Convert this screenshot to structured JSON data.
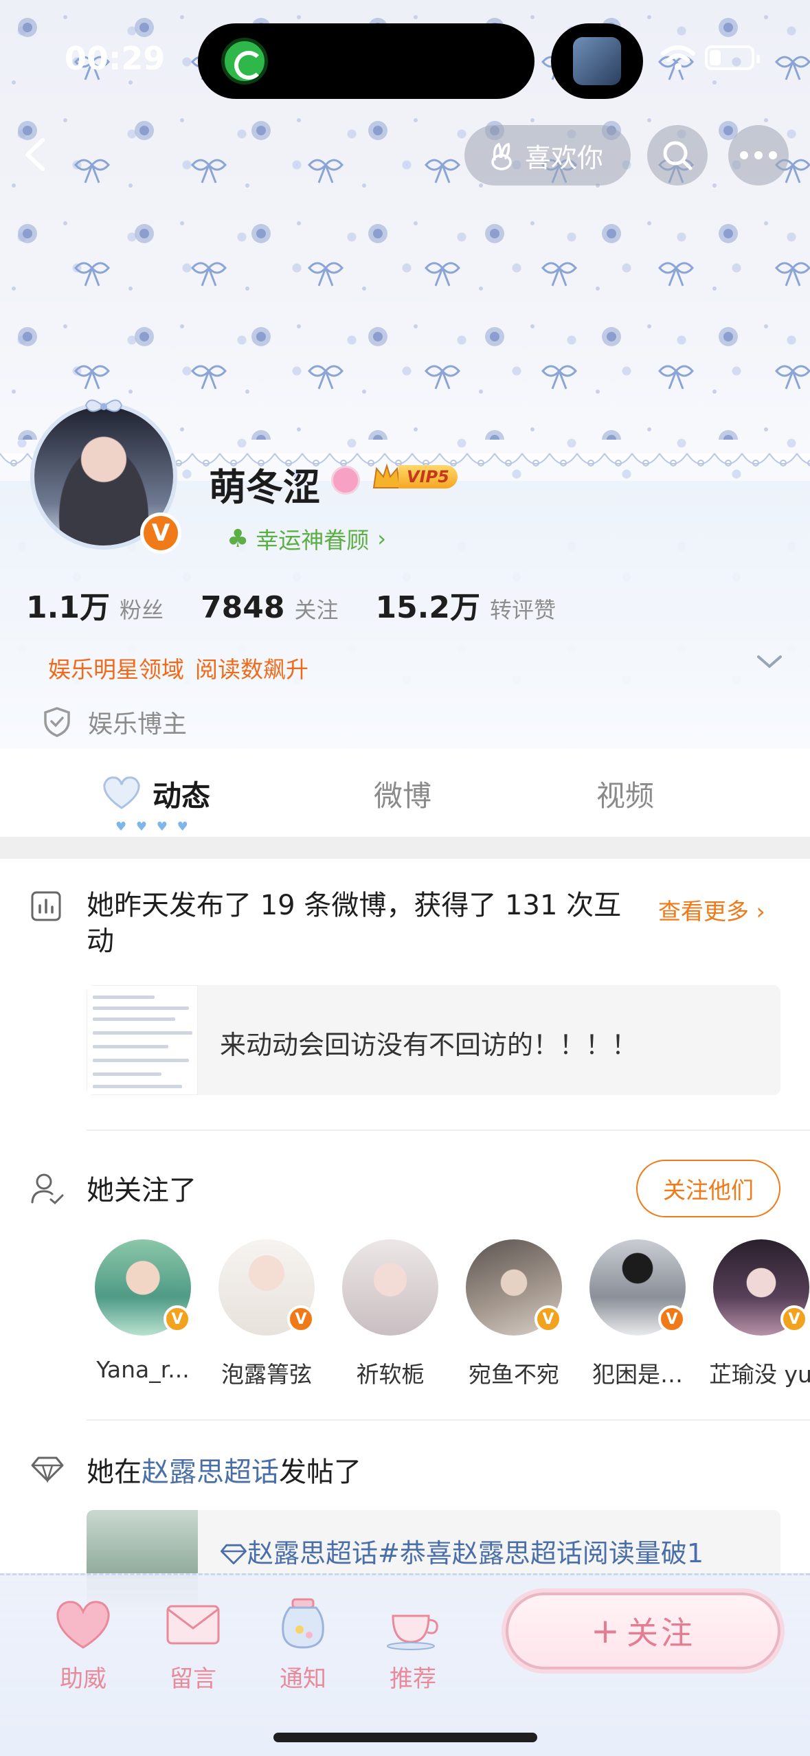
{
  "status_bar": {
    "time": "00:29"
  },
  "nav": {
    "like_label": "喜欢你"
  },
  "profile": {
    "name": "萌冬涩",
    "verified_badge": "V",
    "vip_label": "VIP5",
    "luck_label": "幸运神眷顾",
    "luck_chevron": "›",
    "stats": [
      {
        "value": "1.1万",
        "label": "粉丝"
      },
      {
        "value": "7848",
        "label": "关注"
      },
      {
        "value": "15.2万",
        "label": "转评赞"
      }
    ],
    "tags": [
      "娱乐明星领域",
      "阅读数飙升"
    ],
    "certification": "娱乐博主"
  },
  "tabs": [
    {
      "label": "动态",
      "active": true
    },
    {
      "label": "微博",
      "active": false
    },
    {
      "label": "视频",
      "active": false
    }
  ],
  "summary": {
    "text": "她昨天发布了 19 条微博，获得了 131 次互动",
    "see_more": "查看更多",
    "see_more_chevron": "›",
    "post_text": "来动动会回访没有不回访的！！！！"
  },
  "following": {
    "title": "她关注了",
    "button": "关注他们",
    "users": [
      {
        "name": "Yana_r...",
        "badge": "V",
        "badge_color": "#f3a21d"
      },
      {
        "name": "泡露箐弦",
        "badge": "V",
        "badge_color": "#f07a18"
      },
      {
        "name": "祈软栀",
        "badge": "",
        "badge_color": ""
      },
      {
        "name": "宛鱼不宛",
        "badge": "V",
        "badge_color": "#f3a21d"
      },
      {
        "name": "犯困是…",
        "badge": "V",
        "badge_color": "#f07a18"
      },
      {
        "name": "芷瑜没 yu",
        "badge": "V",
        "badge_color": "#f3a21d"
      }
    ]
  },
  "supertopic": {
    "prefix": "她在",
    "link": "赵露思超话",
    "suffix": "发帖了",
    "post_text": "赵露思超话#恭喜赵露思超话阅读量破1"
  },
  "bottom_bar": {
    "items": [
      "助威",
      "留言",
      "通知",
      "推荐"
    ],
    "follow_plus": "+",
    "follow_label": "关注"
  },
  "colors": {
    "accent": "#f07a18",
    "link": "#4a6fa8",
    "pink": "#e98a9b"
  }
}
